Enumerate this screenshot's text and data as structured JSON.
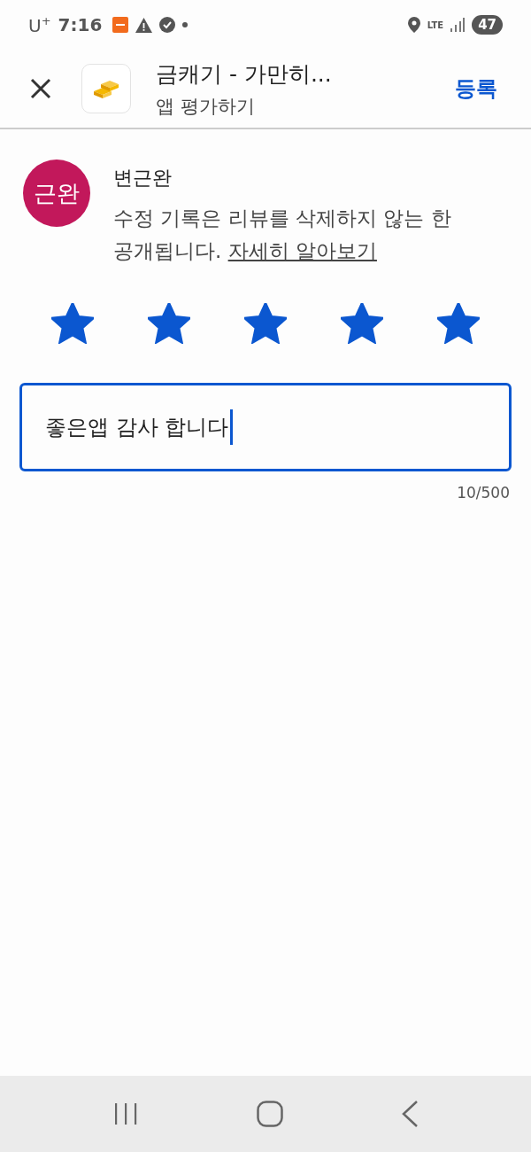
{
  "status_bar": {
    "carrier": "U",
    "carrier_sup": "+",
    "time": "7:16",
    "network": "LTE",
    "battery": "47"
  },
  "header": {
    "title": "금캐기 - 가만히...",
    "subtitle": "앱 평가하기",
    "action": "등록"
  },
  "user": {
    "avatar_text": "근완",
    "name": "변근완",
    "notice": "수정 기록은 리뷰를 삭제하지 않는 한 공개됩니다.",
    "link": "자세히 알아보기"
  },
  "rating": {
    "stars": 5
  },
  "review": {
    "value": "좋은앱 감사 합니다",
    "counter": "10/500"
  }
}
